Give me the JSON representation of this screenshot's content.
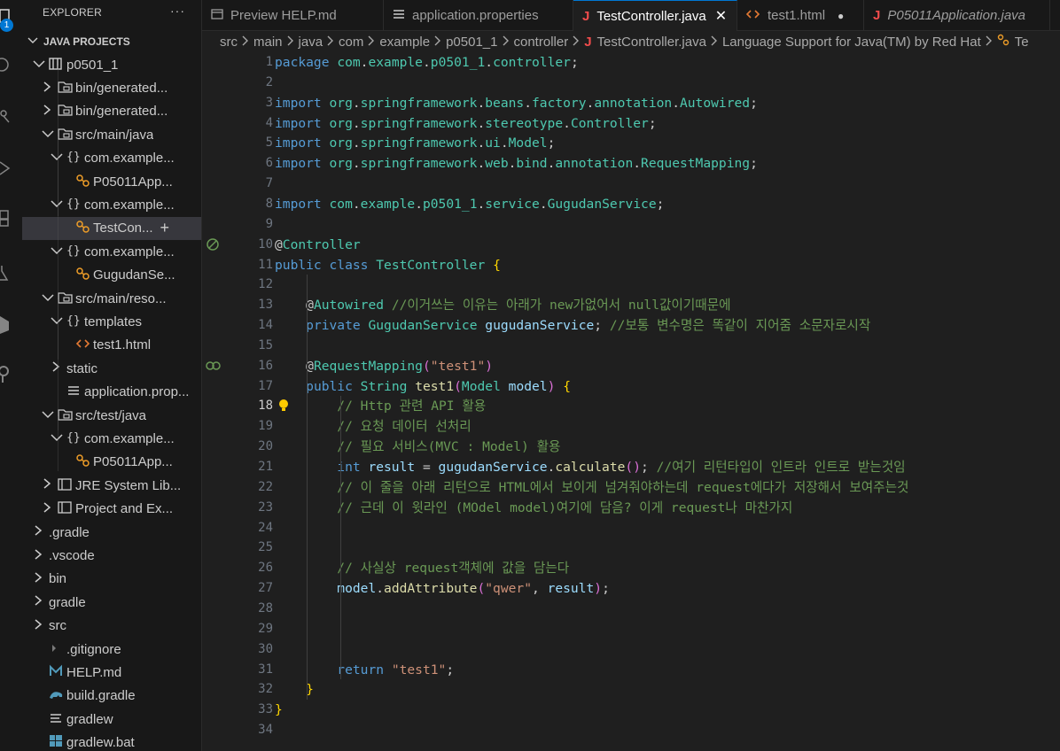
{
  "activity_bar": {
    "badge_count": "1"
  },
  "sidebar": {
    "title": "EXPLORER",
    "more_label": "···",
    "section_title": "JAVA PROJECTS",
    "tree": [
      {
        "label": "p0501_1",
        "icon": "project-icon",
        "chev": "v"
      },
      {
        "label": "bin/generated...",
        "icon": "package-folder-icon",
        "chev": ">"
      },
      {
        "label": "bin/generated...",
        "icon": "package-folder-icon",
        "chev": ">"
      },
      {
        "label": "src/main/java",
        "icon": "package-folder-icon",
        "chev": "v"
      },
      {
        "label": "com.example...",
        "icon": "package-icon",
        "chev": "v"
      },
      {
        "label": "P05011App...",
        "icon": "class-icon",
        "chev": ""
      },
      {
        "label": "com.example...",
        "icon": "package-icon",
        "chev": "v"
      },
      {
        "label": "TestCon...",
        "icon": "class-icon",
        "chev": "",
        "selected": true
      },
      {
        "label": "com.example...",
        "icon": "package-icon",
        "chev": "v"
      },
      {
        "label": "GugudanSe...",
        "icon": "class-icon",
        "chev": ""
      },
      {
        "label": "src/main/reso...",
        "icon": "package-folder-icon",
        "chev": "v"
      },
      {
        "label": "templates",
        "icon": "package-icon",
        "chev": "v"
      },
      {
        "label": "test1.html",
        "icon": "html-icon",
        "chev": ""
      },
      {
        "label": "static",
        "icon": "",
        "chev": ">"
      },
      {
        "label": "application.prop...",
        "icon": "properties-icon",
        "chev": ""
      },
      {
        "label": "src/test/java",
        "icon": "package-folder-icon",
        "chev": "v"
      },
      {
        "label": "com.example...",
        "icon": "package-icon",
        "chev": "v"
      },
      {
        "label": "P05011App...",
        "icon": "class-icon",
        "chev": ""
      },
      {
        "label": "JRE System Lib...",
        "icon": "library-icon",
        "chev": ">"
      },
      {
        "label": "Project and Ex...",
        "icon": "library-icon",
        "chev": ">"
      },
      {
        "label": ".gradle",
        "icon": "",
        "chev": ">"
      },
      {
        "label": ".vscode",
        "icon": "",
        "chev": ">"
      },
      {
        "label": "bin",
        "icon": "",
        "chev": ">"
      },
      {
        "label": "gradle",
        "icon": "",
        "chev": ">"
      },
      {
        "label": "src",
        "icon": "",
        "chev": ">"
      },
      {
        "label": ".gitignore",
        "icon": "gitignore-icon",
        "chev": ""
      },
      {
        "label": "HELP.md",
        "icon": "markdown-icon",
        "chev": ""
      },
      {
        "label": "build.gradle",
        "icon": "gradle-icon",
        "chev": ""
      },
      {
        "label": "gradlew",
        "icon": "file-lines-icon",
        "chev": ""
      },
      {
        "label": "gradlew.bat",
        "icon": "windows-icon",
        "chev": ""
      }
    ]
  },
  "tabs": [
    {
      "label": "Preview HELP.md",
      "icon": "preview-icon"
    },
    {
      "label": "application.properties",
      "icon": "properties-icon"
    },
    {
      "label": "TestController.java",
      "icon": "java-icon",
      "active": true,
      "close": "✕"
    },
    {
      "label": "test1.html",
      "icon": "html-icon",
      "dirty": "●"
    },
    {
      "label": "P05011Application.java",
      "icon": "java-icon",
      "italic": true
    }
  ],
  "breadcrumbs": [
    "src",
    "main",
    "java",
    "com",
    "example",
    "p0501_1",
    "controller",
    "TestController.java",
    "Language Support for Java(TM) by Red Hat",
    "Te"
  ],
  "editor": {
    "current_line": 18,
    "lines": [
      "package com.example.p0501_1.controller;",
      "",
      "import org.springframework.beans.factory.annotation.Autowired;",
      "import org.springframework.stereotype.Controller;",
      "import org.springframework.ui.Model;",
      "import org.springframework.web.bind.annotation.RequestMapping;",
      "",
      "import com.example.p0501_1.service.GugudanService;",
      "",
      "@Controller",
      "public class TestController {",
      "",
      "    @Autowired //이거쓰는 이유는 아래가 new가없어서 null값이기때문에",
      "    private GugudanService gugudanService; //보통 변수명은 똑같이 지어줌 소문자로시작",
      "",
      "    @RequestMapping(\"test1\")",
      "    public String test1(Model model) {",
      "        // Http 관련 API 활용",
      "        // 요청 데이터 선처리",
      "        // 필요 서비스(MVC : Model) 활용",
      "        int result = gugudanService.calculate(); //여기 리턴타입이 인트라 인트로 받는것임",
      "        // 이 줄을 아래 리턴으로 HTML에서 보이게 넘겨줘야하는데 request에다가 저장해서 보여주는것",
      "        // 근데 이 윗라인 (MOdel model)여기에 담음? 이게 request나 마찬가지",
      "",
      "",
      "        // 사실상 request객체에 값을 담는다",
      "        model.addAttribute(\"qwer\", result);",
      "",
      "",
      "",
      "        return \"test1\";",
      "    }",
      "}",
      ""
    ]
  }
}
